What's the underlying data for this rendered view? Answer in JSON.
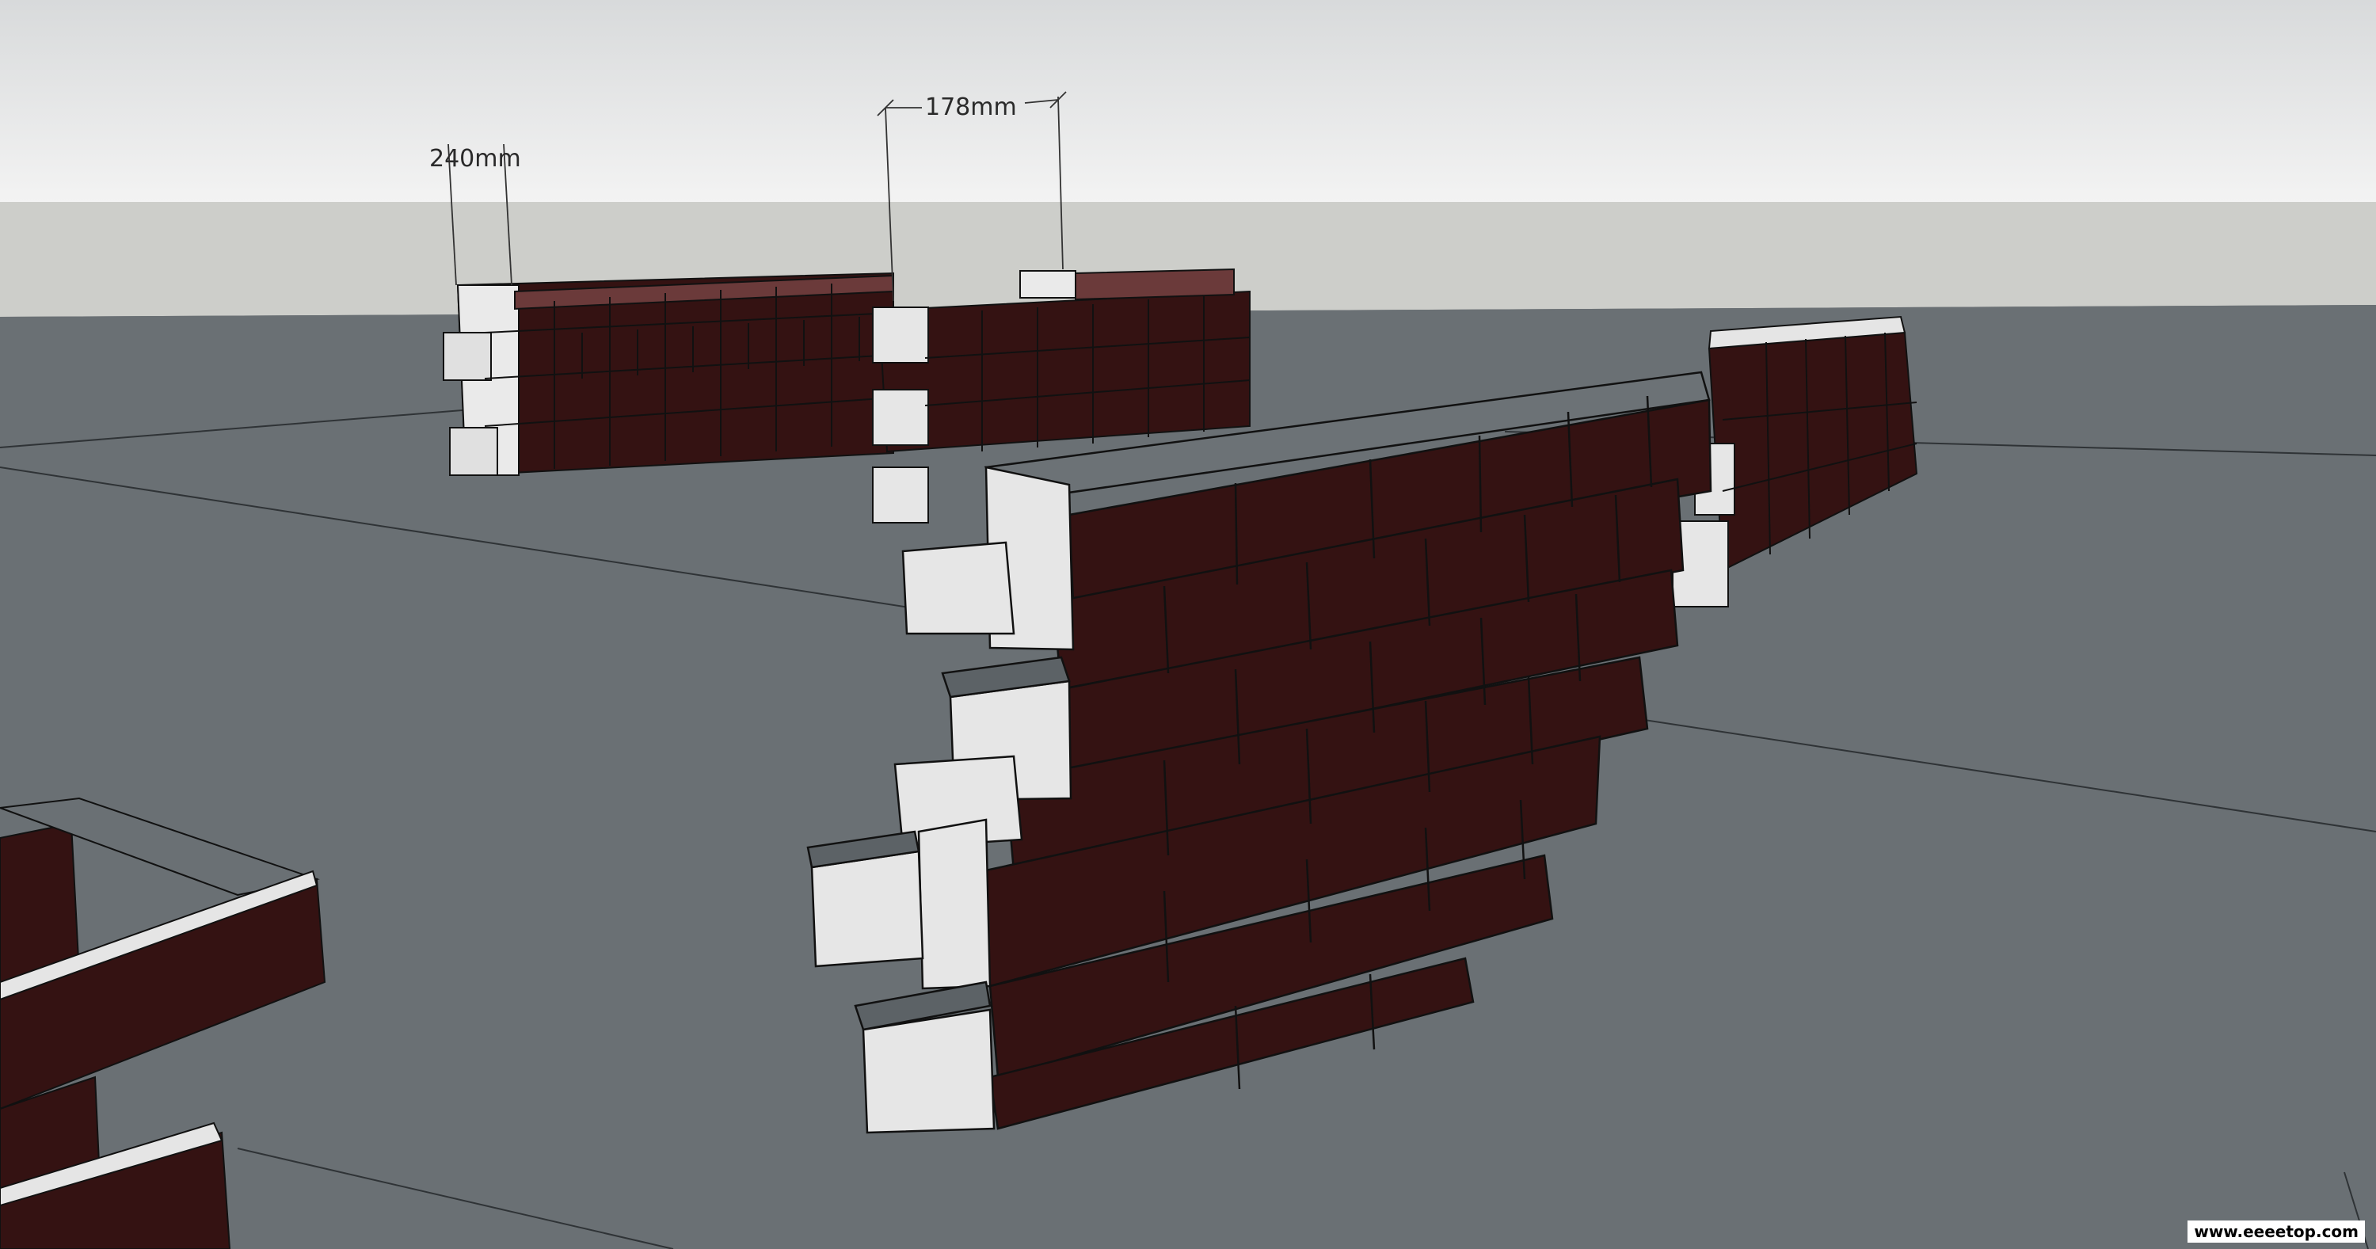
{
  "dimensions": {
    "width_label": "240mm",
    "gap_label": "178mm"
  },
  "watermark": "www.eeeetop.com",
  "colors": {
    "brick": "#341212",
    "mortar": "#e8e8e8",
    "ground": "#6a7074",
    "sky_top": "#e6e7e7",
    "sky_band": "#cdceca"
  }
}
